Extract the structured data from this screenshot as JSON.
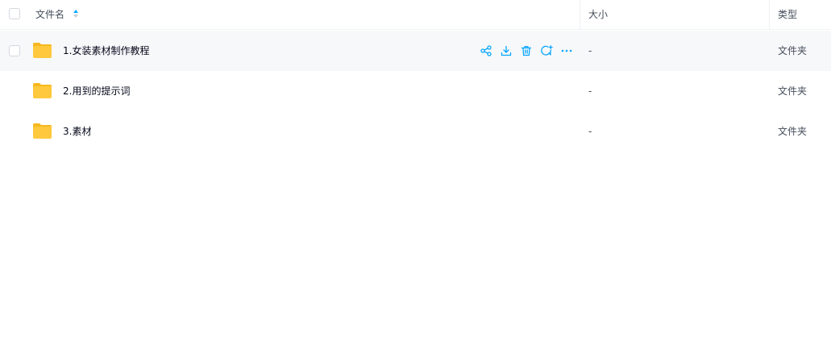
{
  "header": {
    "name_label": "文件名",
    "size_label": "大小",
    "type_label": "类型"
  },
  "files": [
    {
      "name": "1.女装素材制作教程",
      "size": "-",
      "type": "文件夹",
      "icon": "folder-icon"
    },
    {
      "name": "2.用到的提示词",
      "size": "-",
      "type": "文件夹",
      "icon": "folder-icon"
    },
    {
      "name": "3.素材",
      "size": "-",
      "type": "文件夹",
      "icon": "folder-icon"
    }
  ],
  "row_actions": [
    "share-icon",
    "download-icon",
    "delete-icon",
    "add-comment-icon",
    "more-icon"
  ],
  "colors": {
    "accent": "#06a7ff",
    "folder": "#ffc83d",
    "hover_row": "#f7f8fa"
  }
}
